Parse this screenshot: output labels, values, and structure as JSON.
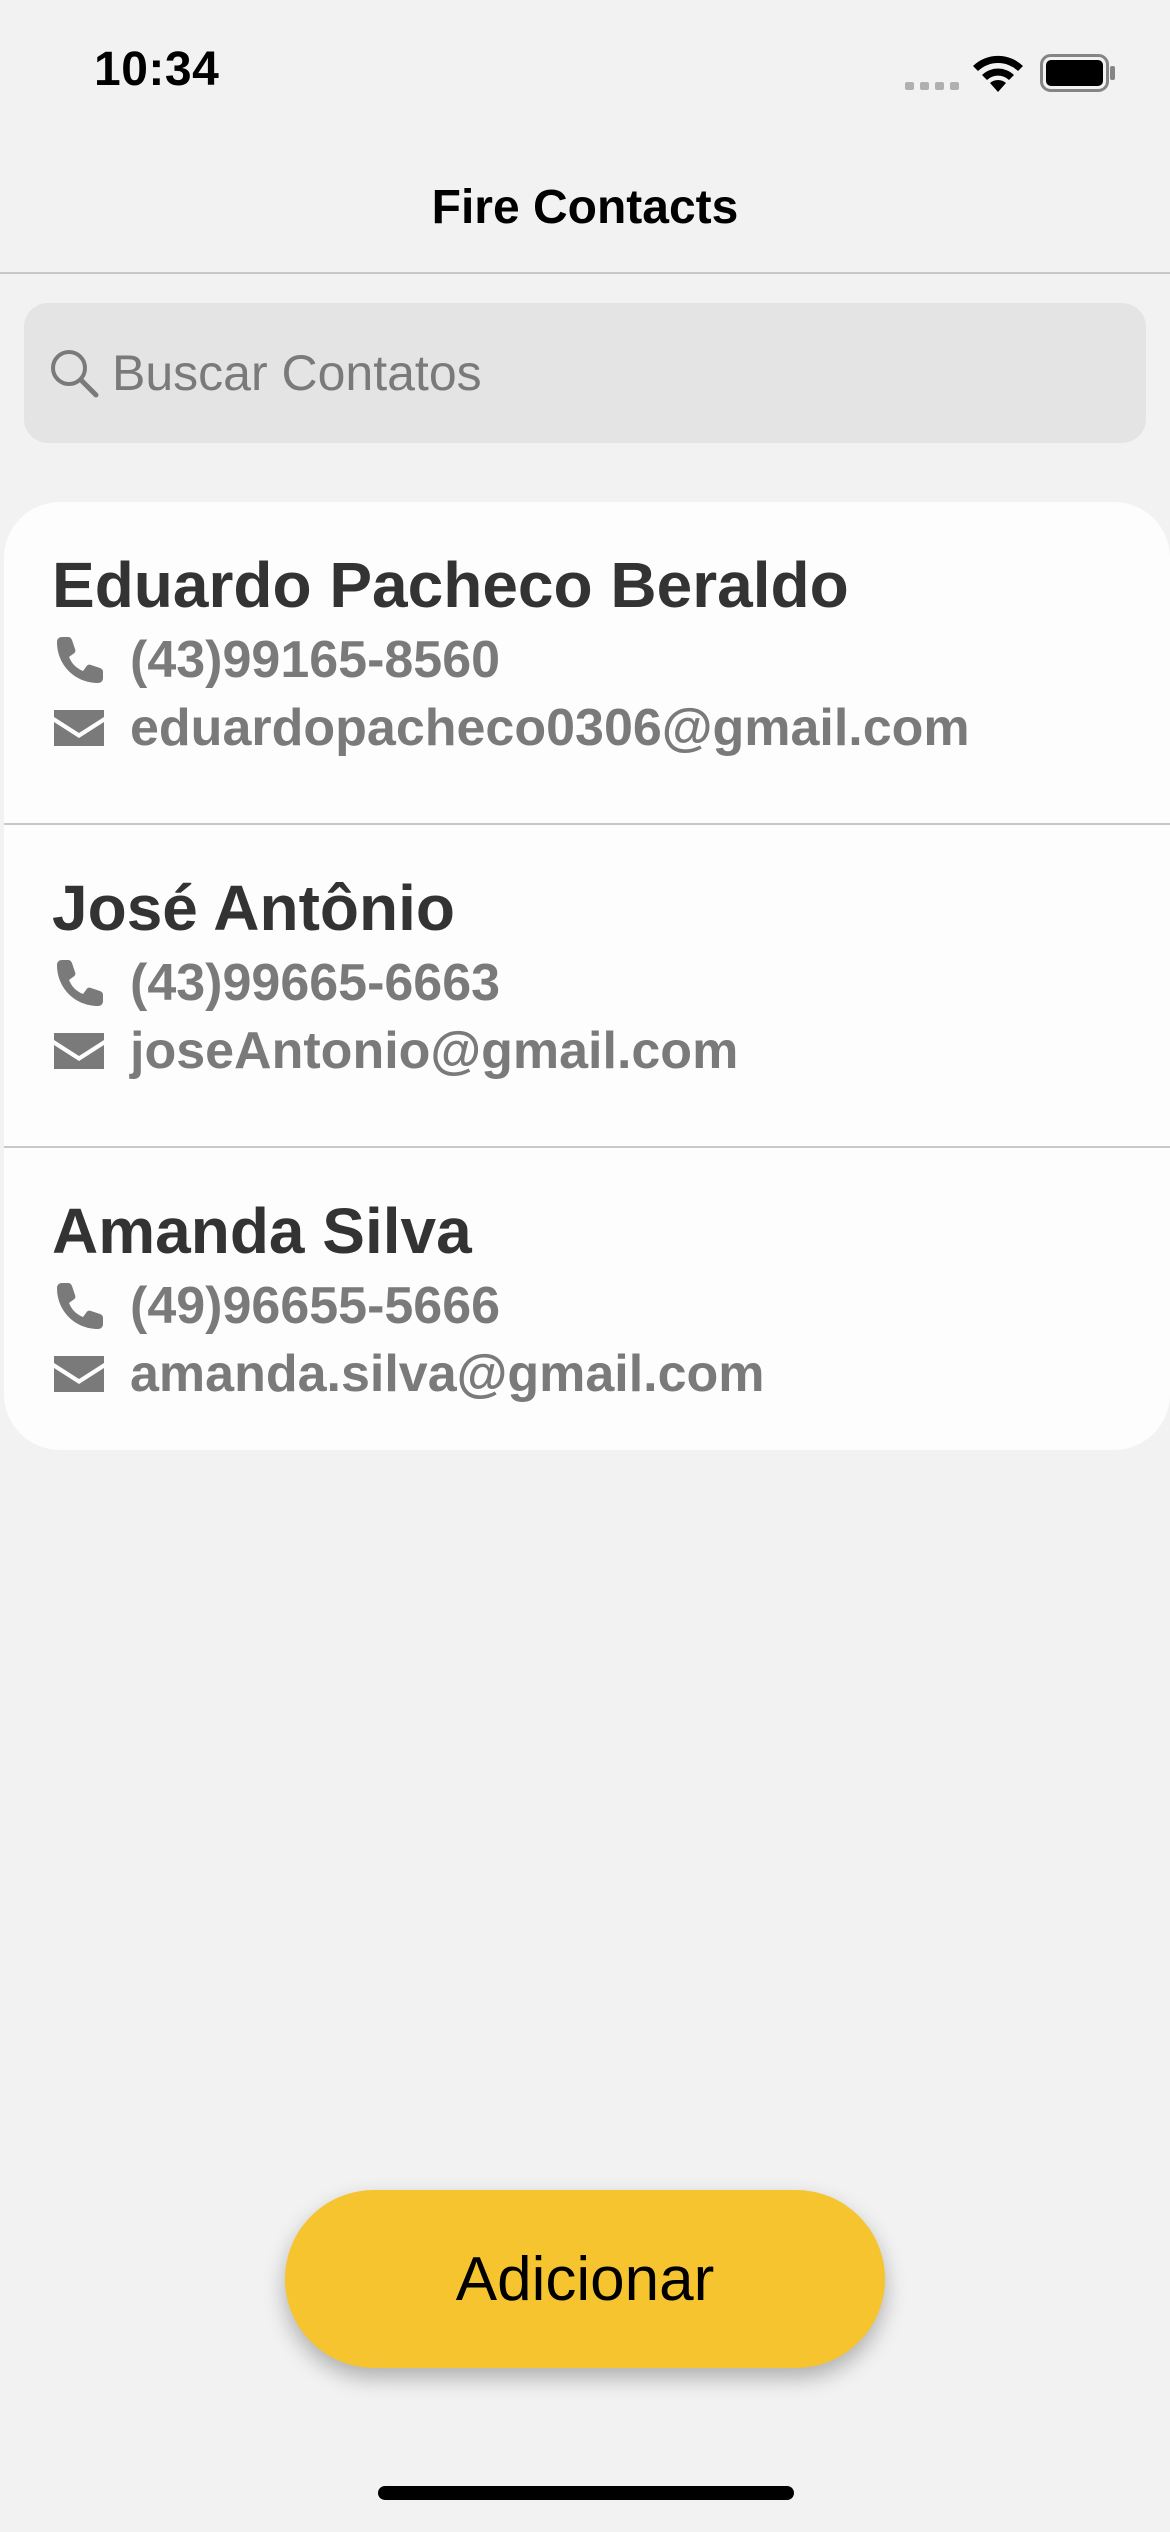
{
  "status_bar": {
    "time": "10:34"
  },
  "nav": {
    "title": "Fire Contacts"
  },
  "search": {
    "placeholder": "Buscar Contatos",
    "value": ""
  },
  "contacts": [
    {
      "name": "Eduardo Pacheco Beraldo",
      "phone": "(43)99165-8560",
      "email": "eduardopacheco0306@gmail.com"
    },
    {
      "name": "José Antônio",
      "phone": "(43)99665-6663",
      "email": "joseAntonio@gmail.com"
    },
    {
      "name": "Amanda Silva",
      "phone": "(49)96655-5666",
      "email": "amanda.silva@gmail.com"
    }
  ],
  "actions": {
    "add_label": "Adicionar"
  },
  "colors": {
    "accent": "#f6c42e",
    "background": "#f2f2f2",
    "card": "#fdfdfd",
    "secondary_text": "#7a7a7a"
  },
  "icons": {
    "phone": "phone-icon",
    "email": "envelope-icon",
    "search": "search-icon"
  }
}
